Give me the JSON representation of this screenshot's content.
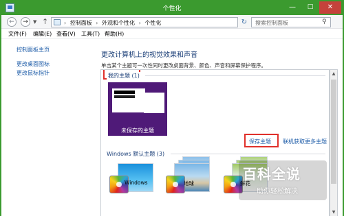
{
  "window": {
    "title": "个性化",
    "min_label": "—",
    "max_label": "□",
    "close_label": "✕",
    "accent_color": "#3b9a2f"
  },
  "address": {
    "crumbs": [
      "控制面板",
      "外观和个性化",
      "个性化"
    ],
    "search_placeholder": "搜索控制面板"
  },
  "menu": {
    "items": [
      "文件(F)",
      "编辑(E)",
      "查看(V)",
      "工具(T)",
      "帮助(H)"
    ]
  },
  "sidebar": {
    "links": [
      "控制面板主页",
      "更改桌面图标",
      "更改鼠标指针"
    ]
  },
  "main": {
    "heading": "更改计算机上的视觉效果和声音",
    "description": "单击某个主题可一次性同时更改桌面背景、颜色、声音和屏幕保护程序。",
    "my_themes_group": "我的主题 (1)",
    "unsaved_theme": "未保存的主题",
    "save_theme": "保存主题",
    "online_themes": "联机获取更多主题",
    "windows_group": "Windows 默认主题 (3)",
    "themes": [
      "Windows",
      "地球",
      "鲜花"
    ]
  },
  "watermark": {
    "title": "百科全说",
    "subtitle": "助你轻松解决"
  }
}
